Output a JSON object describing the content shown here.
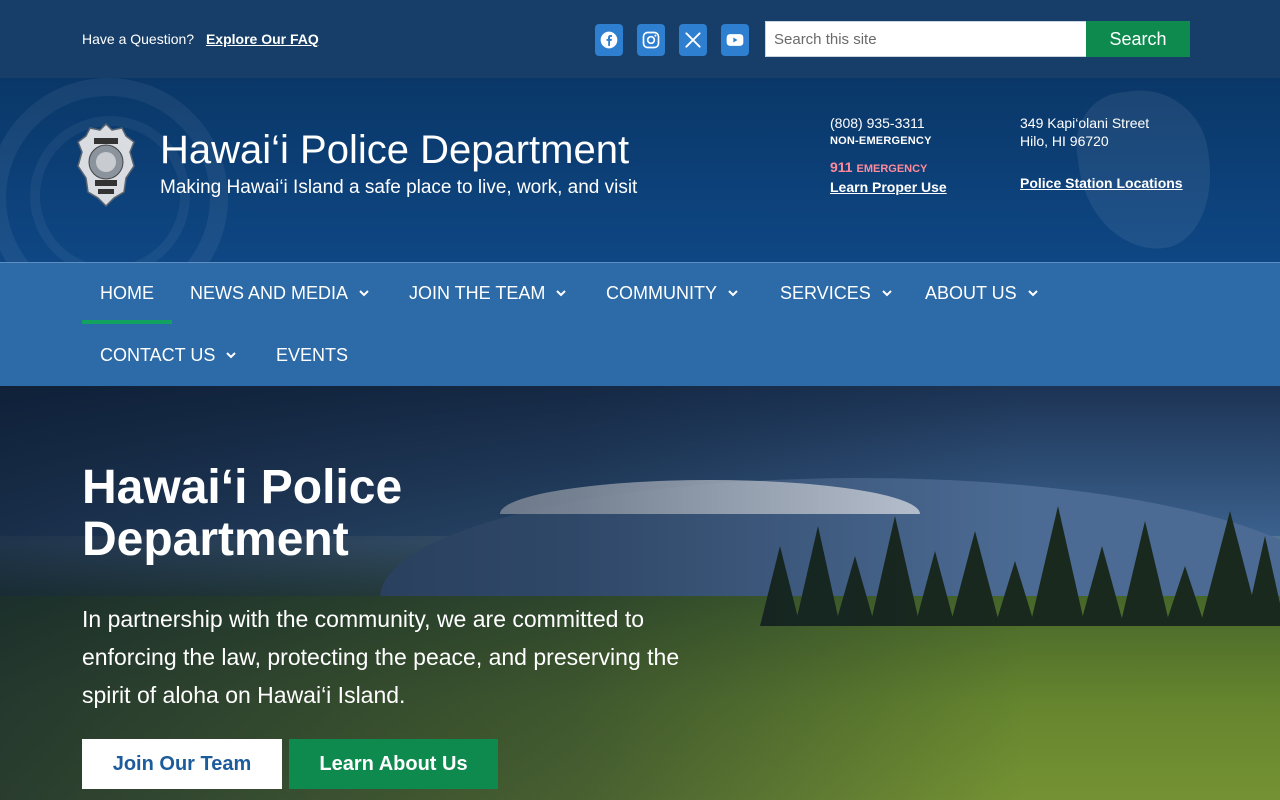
{
  "topbar": {
    "question_text": "Have a Question?",
    "faq_link": "Explore Our FAQ",
    "socials": [
      "facebook-icon",
      "instagram-icon",
      "x-icon",
      "youtube-icon"
    ],
    "search_placeholder": "Search this site",
    "search_button": "Search"
  },
  "header": {
    "title": "Hawai‘i Police Department",
    "tagline": "Making Hawai‘i Island a safe place to live, work, and visit",
    "phone": "(808) 935-3311",
    "phone_label": "NON-EMERGENCY",
    "emergency_number": "911",
    "emergency_label": "EMERGENCY",
    "emergency_link": "Learn Proper Use",
    "address_line1": "349 Kapi‘olani Street",
    "address_line2": "Hilo, HI 96720",
    "locations_link": "Police Station Locations"
  },
  "nav": {
    "items": [
      {
        "label": "HOME",
        "dropdown": false,
        "active": true
      },
      {
        "label": "NEWS AND MEDIA",
        "dropdown": true
      },
      {
        "label": "JOIN THE TEAM",
        "dropdown": true
      },
      {
        "label": "COMMUNITY",
        "dropdown": true
      },
      {
        "label": "SERVICES",
        "dropdown": true
      },
      {
        "label": "ABOUT US",
        "dropdown": true
      },
      {
        "label": "CONTACT US",
        "dropdown": true
      },
      {
        "label": "EVENTS",
        "dropdown": false
      }
    ]
  },
  "hero": {
    "title": "Hawai‘i Police Department",
    "text": "In partnership with the community, we are committed to enforcing the law, protecting the peace, and preserving the spirit of aloha on Hawai‘i Island.",
    "button_primary": "Join Our Team",
    "button_secondary": "Learn About Us"
  },
  "colors": {
    "topbar": "#163e69",
    "header": "#0e4784",
    "nav": "#2c6aa8",
    "accent_green": "#0f8a4f",
    "emergency": "#ff8a9a"
  }
}
